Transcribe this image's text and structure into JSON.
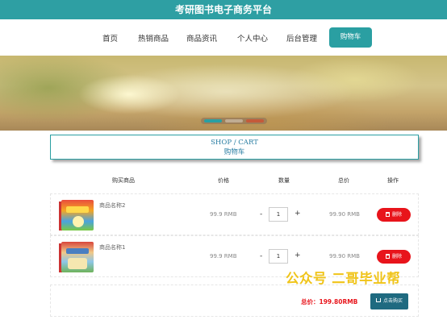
{
  "site": {
    "title": "考研图书电子商务平台"
  },
  "nav": {
    "items": [
      "首页",
      "热销商品",
      "商品资讯",
      "个人中心",
      "后台管理"
    ],
    "cart_label": "购物车"
  },
  "banner": {
    "slide_count": 3,
    "active_slide": 1
  },
  "shop_title": {
    "en": "SHOP / CART",
    "cn": "购物车"
  },
  "table": {
    "headers": [
      "购买商品",
      "价格",
      "数量",
      "总价",
      "操作"
    ],
    "rows": [
      {
        "name": "商品名称2",
        "price": "99.9 RMB",
        "minus": "-",
        "qty": "1",
        "plus": "+",
        "total": "99.90 RMB",
        "delete_label": "删除"
      },
      {
        "name": "商品名称1",
        "price": "99.9 RMB",
        "minus": "-",
        "qty": "1",
        "plus": "+",
        "total": "99.90 RMB",
        "delete_label": "删除"
      }
    ]
  },
  "summary": {
    "total_label": "总价：199.80RMB",
    "buy_label": "点击购买"
  },
  "watermark": "公众号 二哥毕业帮",
  "colors": {
    "accent": "#2a9fa2",
    "danger": "#e8141b",
    "buy": "#1f6a80",
    "watermark": "#f0c419"
  }
}
